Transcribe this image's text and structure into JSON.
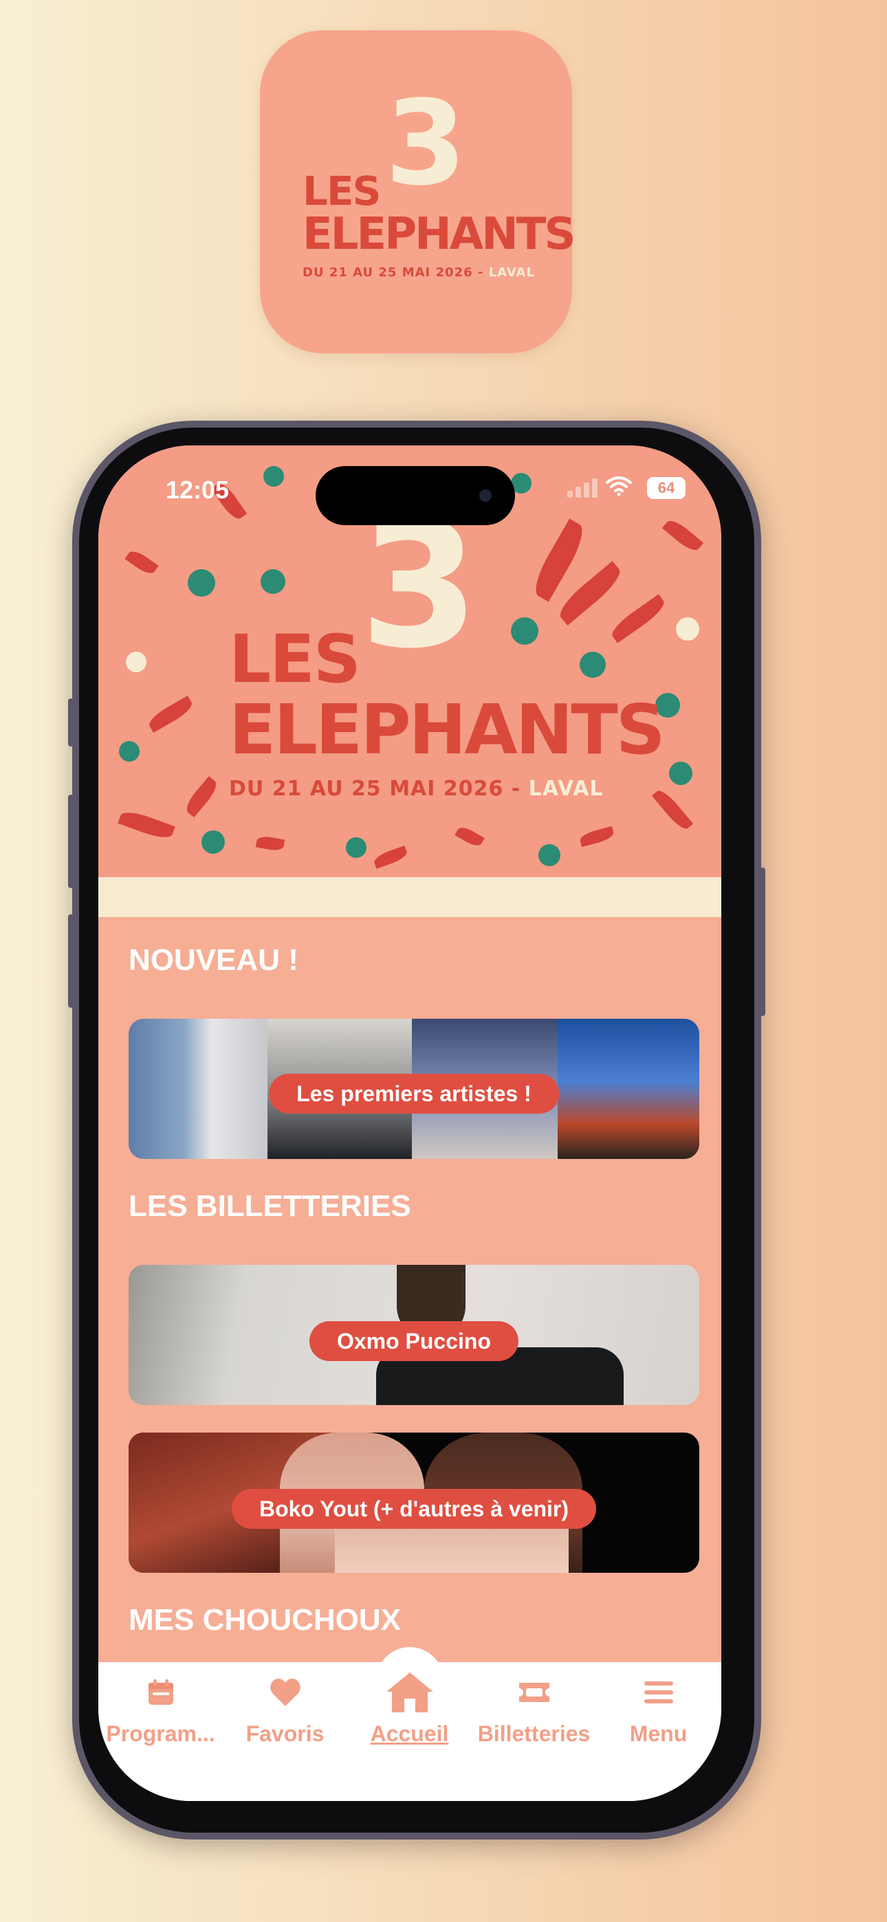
{
  "app_icon": {
    "logo_les": "LES",
    "logo_number": "3",
    "logo_name": "ELEPHANTS",
    "logo_dates": "DU 21 AU 25 MAI 2026 -",
    "logo_city": "LAVAL"
  },
  "status_bar": {
    "time": "12:05",
    "battery": "64"
  },
  "hero": {
    "logo_les": "LES",
    "logo_number": "3",
    "logo_name": "ELEPHANTS",
    "logo_dates": "DU 21 AU 25 MAI 2026 -",
    "logo_city": "LAVAL"
  },
  "sections": {
    "nouveau": {
      "title": "NOUVEAU !",
      "card_label": "Les premiers artistes !"
    },
    "billetteries": {
      "title": "LES BILLETTERIES",
      "cards": [
        {
          "label": "Oxmo Puccino"
        },
        {
          "label": "Boko Yout (+ d'autres à venir)"
        }
      ]
    },
    "chouchoux": {
      "title": "MES CHOUCHOUX"
    }
  },
  "tabbar": {
    "items": [
      {
        "label": "Program...",
        "icon": "calendar-icon"
      },
      {
        "label": "Favoris",
        "icon": "heart-icon"
      },
      {
        "label": "Accueil",
        "icon": "home-icon",
        "active": true
      },
      {
        "label": "Billetteries",
        "icon": "ticket-icon"
      },
      {
        "label": "Menu",
        "icon": "menu-icon"
      }
    ]
  },
  "colors": {
    "brand_salmon": "#f6a58c",
    "brand_red": "#d94a3a",
    "cream": "#f7edd4",
    "tab_inactive": "#f2a087"
  }
}
